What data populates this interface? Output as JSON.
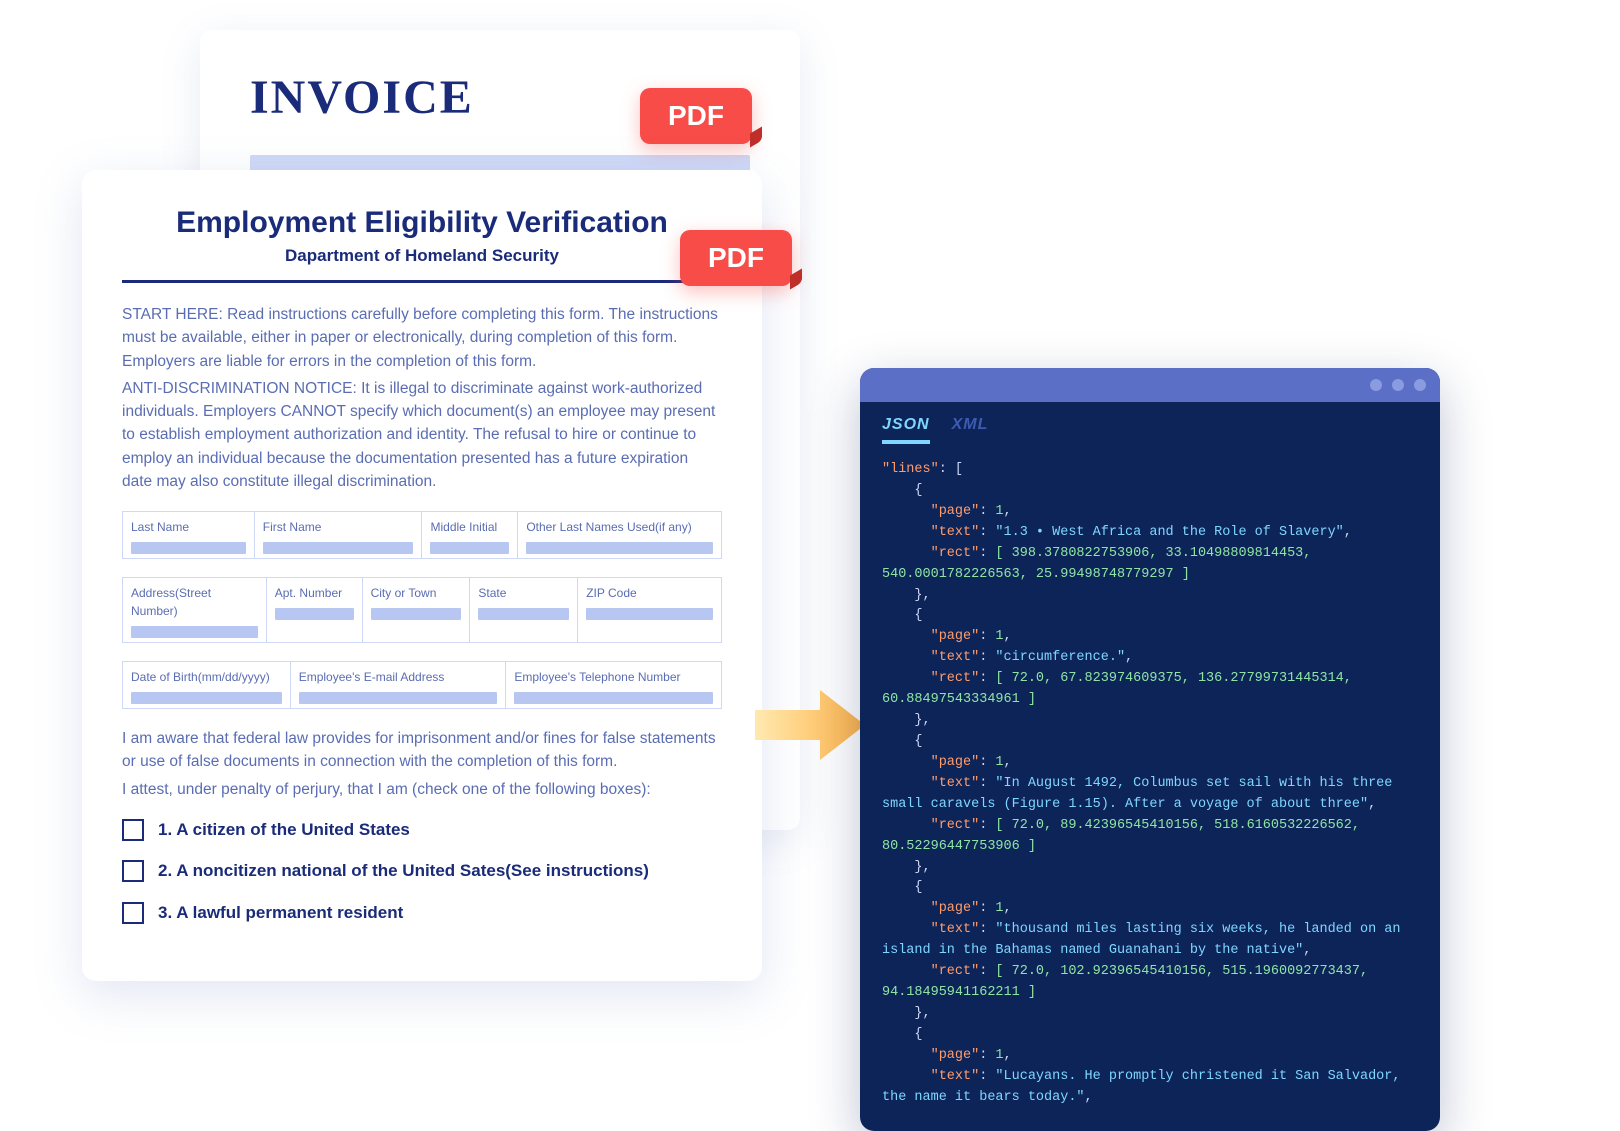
{
  "invoice": {
    "title": "INVOICE"
  },
  "pdf_badge": "PDF",
  "form": {
    "title": "Employment Eligibility Verification",
    "subtitle": "Dapartment of Homeland Security",
    "start_here": "START HERE: Read instructions carefully before completing this form. The instructions must be available, either in paper or electronically, during completion of this form. Employers are liable for errors in the completion of this form.",
    "anti_disc": "ANTI-DISCRIMINATION NOTICE: It is illegal to discriminate against work-authorized individuals. Employers CANNOT specify which document(s) an employee may present to establish employment authorization and identity. The refusal to hire or continue to employ an individual because the documentation presented has a future expiration date may also constitute illegal discrimination.",
    "fields": {
      "last_name": "Last Name",
      "first_name": "First Name",
      "middle_initial": "Middle Initial",
      "other_names": "Other Last Names Used(if any)",
      "address": "Address(Street Number)",
      "apt": "Apt. Number",
      "city": "City or Town",
      "state": "State",
      "zip": "ZIP Code",
      "dob": "Date of Birth(mm/dd/yyyy)",
      "email": "Employee's E-mail Address",
      "phone": "Employee's Telephone Number"
    },
    "aware": "I am aware that federal law provides for imprisonment and/or fines for false statements or use of false documents in connection with the completion of this form.",
    "attest": "I attest, under penalty of perjury, that I am (check one of the following boxes):",
    "checks": [
      "1. A citizen of the United States",
      "2. A noncitizen national of the United Sates(See instructions)",
      "3. A lawful permanent resident"
    ]
  },
  "code": {
    "tabs": {
      "json": "JSON",
      "xml": "XML"
    },
    "lines_key": "\"lines\"",
    "page_key": "\"page\"",
    "text_key": "\"text\"",
    "rect_key": "\"rect\"",
    "entries": [
      {
        "page": "1",
        "text": "\"1.3 • West Africa and the Role of Slavery\"",
        "rect": "[ 398.3780822753906, 33.10498809814453, 540.0001782226563, 25.99498748779297 ]"
      },
      {
        "page": "1",
        "text": "\"circumference.\"",
        "rect": "[ 72.0, 67.823974609375, 136.27799731445314, 60.88497543334961 ]"
      },
      {
        "page": "1",
        "text": "\"In August 1492, Columbus set sail with his three small caravels (Figure 1.15). After a voyage of about three\"",
        "rect": "[ 72.0, 89.42396545410156, 518.6160532226562, 80.52296447753906 ]"
      },
      {
        "page": "1",
        "text": "\"thousand miles lasting six weeks, he landed on an island in the Bahamas named Guanahani by the native\"",
        "rect": "[ 72.0, 102.92396545410156, 515.1960092773437, 94.18495941162211 ]"
      },
      {
        "page": "1",
        "text": "\"Lucayans. He promptly christened it San Salvador, the name it bears today.\"",
        "rect": ""
      }
    ]
  }
}
